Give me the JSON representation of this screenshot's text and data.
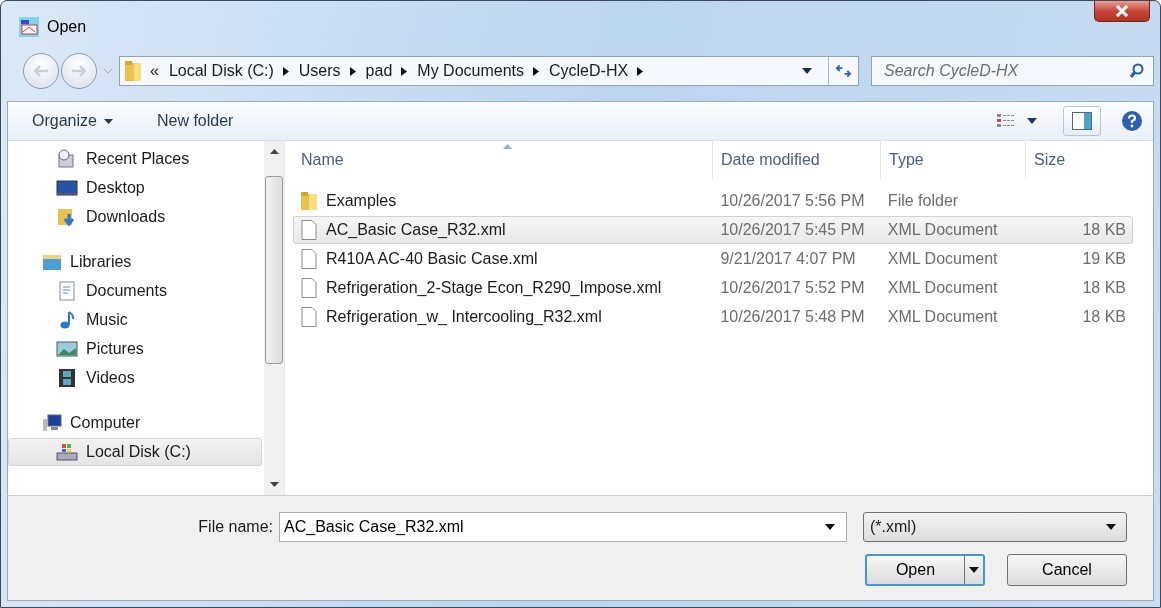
{
  "window": {
    "title": "Open"
  },
  "address": {
    "overflow": "«",
    "crumbs": [
      "Local Disk (C:)",
      "Users",
      "pad",
      "My Documents",
      "CycleD-HX"
    ]
  },
  "search": {
    "placeholder": "Search CycleD-HX"
  },
  "toolbar": {
    "items": [
      {
        "label": "Organize",
        "menu": true
      },
      {
        "label": "New folder",
        "menu": false
      }
    ]
  },
  "sidebar": {
    "groups": [
      {
        "children": [
          {
            "label": "Recent Places",
            "selected": false
          },
          {
            "label": "Desktop",
            "selected": false
          },
          {
            "label": "Downloads",
            "selected": false
          }
        ]
      },
      {
        "label": "Libraries",
        "selected": false,
        "children": [
          {
            "label": "Documents",
            "selected": false
          },
          {
            "label": "Music",
            "selected": false
          },
          {
            "label": "Pictures",
            "selected": false
          },
          {
            "label": "Videos",
            "selected": false
          }
        ]
      },
      {
        "label": "Computer",
        "selected": false,
        "children": [
          {
            "label": "Local Disk (C:)",
            "selected": true
          }
        ]
      }
    ]
  },
  "table": {
    "columns": [
      {
        "label": "Name",
        "sorted": true
      },
      {
        "label": "Date modified",
        "sorted": false
      },
      {
        "label": "Type",
        "sorted": false
      },
      {
        "label": "Size",
        "sorted": false
      }
    ],
    "rows": [
      {
        "kind": "folder",
        "name": "Examples",
        "date": "10/26/2017 5:56 PM",
        "type": "File folder",
        "selected": false
      },
      {
        "kind": "file",
        "name": "AC_Basic Case_R32.xml",
        "date": "10/26/2017 5:45 PM",
        "type": "XML Document",
        "size": "18 KB",
        "selected": true
      },
      {
        "kind": "file",
        "name": "R410A AC-40 Basic Case.xml",
        "date": "9/21/2017 4:07 PM",
        "type": "XML Document",
        "size": "19 KB",
        "selected": false
      },
      {
        "kind": "file",
        "name": "Refrigeration_2-Stage Econ_R290_Impose.xml",
        "date": "10/26/2017 5:52 PM",
        "type": "XML Document",
        "size": "18 KB",
        "selected": false
      },
      {
        "kind": "file",
        "name": "Refrigeration_w_ Intercooling_R32.xml",
        "date": "10/26/2017 5:48 PM",
        "type": "XML Document",
        "size": "18 KB",
        "selected": false
      }
    ]
  },
  "file_name": {
    "label": "File name:",
    "value": "AC_Basic Case_R32.xml"
  },
  "filter": {
    "value": "(*.xml)"
  },
  "buttons": {
    "open": "Open",
    "cancel": "Cancel"
  }
}
